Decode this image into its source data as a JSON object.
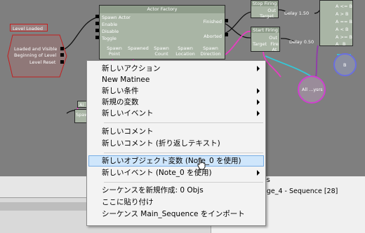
{
  "nodes": {
    "level_loaded": {
      "title": "Level Loaded",
      "outputs": [
        "Loaded and Visible",
        "Beginning of Level",
        "Level Reset"
      ]
    },
    "actor_factory": {
      "title": "Actor Factory",
      "inputs": [
        "Spawn Actor",
        "Enable",
        "Disable",
        "Toggle"
      ],
      "outputs": [
        "Finished",
        "Aborted"
      ],
      "vars": [
        "Spawn Point",
        "Spawned",
        "Spawn Count",
        "Spawn Location",
        "Spawn Direction"
      ]
    },
    "stop_firing": {
      "title": "Stop Firing",
      "out": "Out",
      "target": "Target"
    },
    "start_firing": {
      "title": "Start Firing",
      "out": "Out",
      "target": "Target",
      "fire_at": "Fire At"
    },
    "delay1": "Delay 1.50",
    "delay2": "Delay 0.50",
    "compare_ports": [
      "A <= B",
      "A > B",
      "A == B",
      "A < B",
      "A >= B"
    ],
    "compare_vars": [
      "A",
      "B"
    ],
    "circle_b": "B",
    "circle_alive": "All ...ysrs",
    "small_node_labels": [
      "Ai",
      "Spaw"
    ]
  },
  "bottom": {
    "line1": "es",
    "line2": "age_4 - Sequence [28]"
  },
  "menu": {
    "items": [
      {
        "label": "新しいアクション",
        "sub": true
      },
      {
        "label": "New Matinee",
        "sub": false
      },
      {
        "label": "新しい条件",
        "sub": true
      },
      {
        "label": "新規の変数",
        "sub": true
      },
      {
        "label": "新しいイベント",
        "sub": true
      },
      {
        "label": "新しいコメント",
        "sub": false
      },
      {
        "label": "新しいコメント (折り返しテキスト)",
        "sub": false
      },
      {
        "label": "新しいオブジェクト変数 (Note_0 を使用)",
        "sub": false,
        "highlighted": true
      },
      {
        "label": "新しいイベント (Note_0 を使用)",
        "sub": true
      },
      {
        "label": "シーケンスを新規作成: 0 Objs",
        "sub": false
      },
      {
        "label": "ここに貼り付け",
        "sub": false
      },
      {
        "label": "シーケンス Main_Sequence をインポート",
        "sub": false
      }
    ]
  },
  "colors": {
    "canvas": "#7f7f7f",
    "menu_bg": "#f3f3f3",
    "menu_highlight": "#cfe6fb",
    "menu_highlight_border": "#78aee5",
    "event_node": "#8f7878",
    "action_node": "#a9b5a5",
    "link_pink": "#e63ec0",
    "link_cyan": "#33c8d8",
    "link_purple": "#9040a8"
  }
}
